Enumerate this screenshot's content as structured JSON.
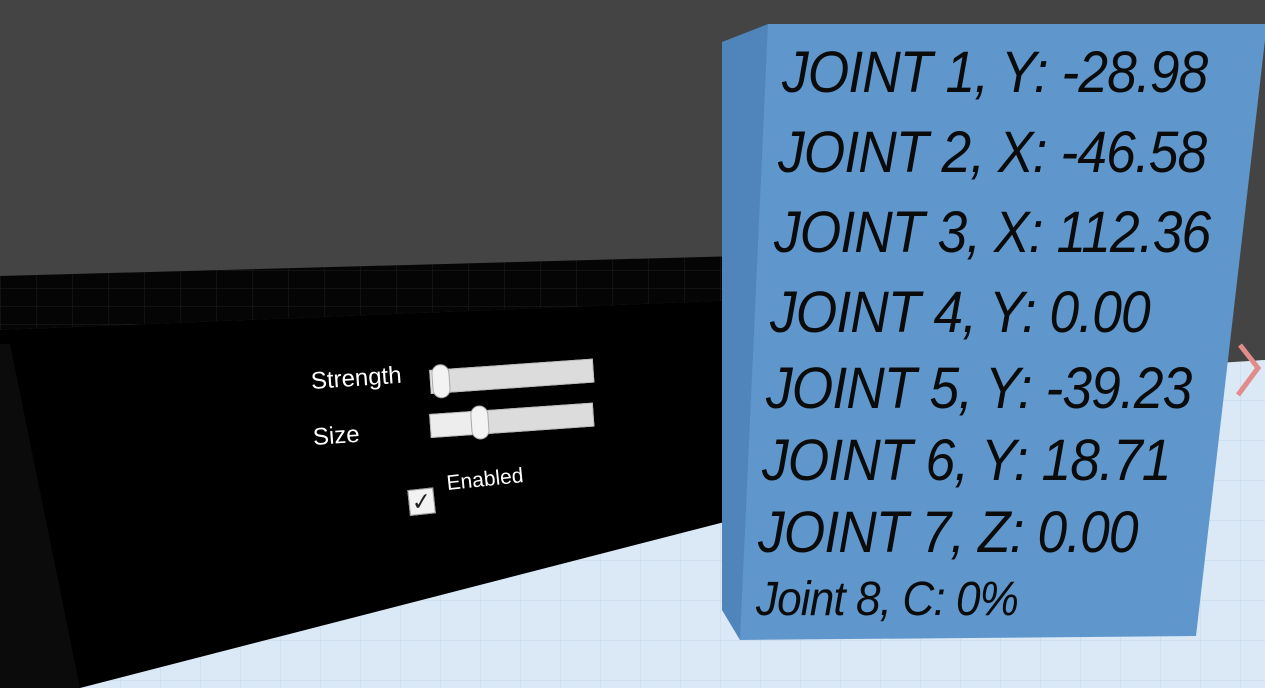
{
  "controls": {
    "strength": {
      "label": "Strength",
      "value": 0.06
    },
    "size": {
      "label": "Size",
      "value": 0.3
    },
    "enabled": {
      "label": "Enabled",
      "checked": true
    }
  },
  "joint_panel": {
    "lines": [
      "JOINT 1, Y: -28.98",
      "JOINT 2, X: -46.58",
      "JOINT 3, X: 112.36",
      "JOINT 4, Y: 0.00",
      "JOINT 5, Y: -39.23",
      "JOINT 6, Y: 18.71",
      "JOINT 7, Z: 0.00",
      "Joint 8, C: 0%"
    ]
  },
  "colors": {
    "background": "#444444",
    "floor": "#dbe9f7",
    "control_panel": "#000000",
    "joint_panel_face": "#5f97cc",
    "joint_panel_side": "#4a7fb5"
  },
  "icons": {
    "checkbox_mark": "checkmark-icon"
  }
}
